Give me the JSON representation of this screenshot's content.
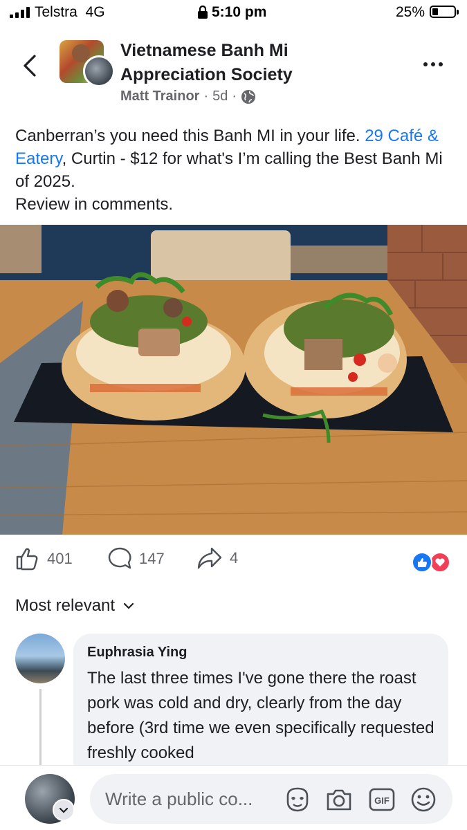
{
  "status_bar": {
    "carrier": "Telstra",
    "network": "4G",
    "time": "5:10 pm",
    "battery": "25%"
  },
  "header": {
    "group_name": "Vietnamese Banh Mi Appreciation Society",
    "author": "Matt Trainor",
    "age": "5d",
    "separator": "·",
    "icons": [
      "back-chevron-icon",
      "globe-icon",
      "more-icon"
    ]
  },
  "post": {
    "text_before": "Canberran’s you need this Banh MI in your life.",
    "link": "29 Café & Eatery",
    "text_after": ", Curtin - $12 for what's I’m calling the Best Banh Mi of 2025.",
    "text_line2": "Review in comments."
  },
  "actions": {
    "likes": "401",
    "comments": "147",
    "shares": "4",
    "reaction_icons": [
      "like-reaction-icon",
      "love-reaction-icon"
    ]
  },
  "sort": {
    "label": "Most relevant"
  },
  "comment": {
    "author": "Euphrasia Ying",
    "text": "The last three times I've gone there the roast pork was cold and dry, clearly from the day before (3rd time we even specifically requested freshly cooked"
  },
  "composer": {
    "placeholder": "Write a public co...",
    "icons": [
      "avatar-sticker-icon",
      "camera-icon",
      "gif-icon",
      "emoji-icon"
    ]
  },
  "colors": {
    "link": "#1877f2",
    "like_blue": "#1877f2",
    "love_red": "#f33e58",
    "bubble": "#f0f2f5",
    "secondary_text": "#65676b"
  }
}
